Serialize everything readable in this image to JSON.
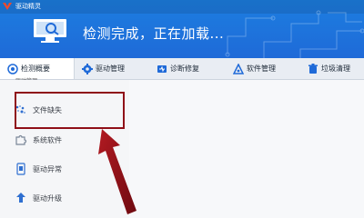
{
  "app": {
    "title": "驱动精灵",
    "status_text": "检测完成，正在加载..."
  },
  "nav": {
    "tabs": [
      {
        "label": "检测概要",
        "icon": "scan-icon",
        "active": true
      },
      {
        "label": "驱动管理",
        "icon": "gear-icon",
        "active": false
      },
      {
        "label": "诊断修复",
        "icon": "stethoscope-icon",
        "active": false
      },
      {
        "label": "软件管理",
        "icon": "software-icon",
        "active": false
      },
      {
        "label": "垃圾清理",
        "icon": "trash-icon",
        "active": false
      }
    ],
    "sub_caption": "驱动管理"
  },
  "sidebar": {
    "items": [
      {
        "label": "文件缺失",
        "icon": "missing-file-icon"
      },
      {
        "label": "系统软件",
        "icon": "puzzle-icon"
      },
      {
        "label": "驱动异常",
        "icon": "driver-error-icon"
      },
      {
        "label": "驱动升级",
        "icon": "upgrade-arrow-icon"
      }
    ]
  },
  "colors": {
    "header": "#1c7ee0",
    "highlight": "#8f0f18",
    "arrow": "#8f0f18"
  }
}
